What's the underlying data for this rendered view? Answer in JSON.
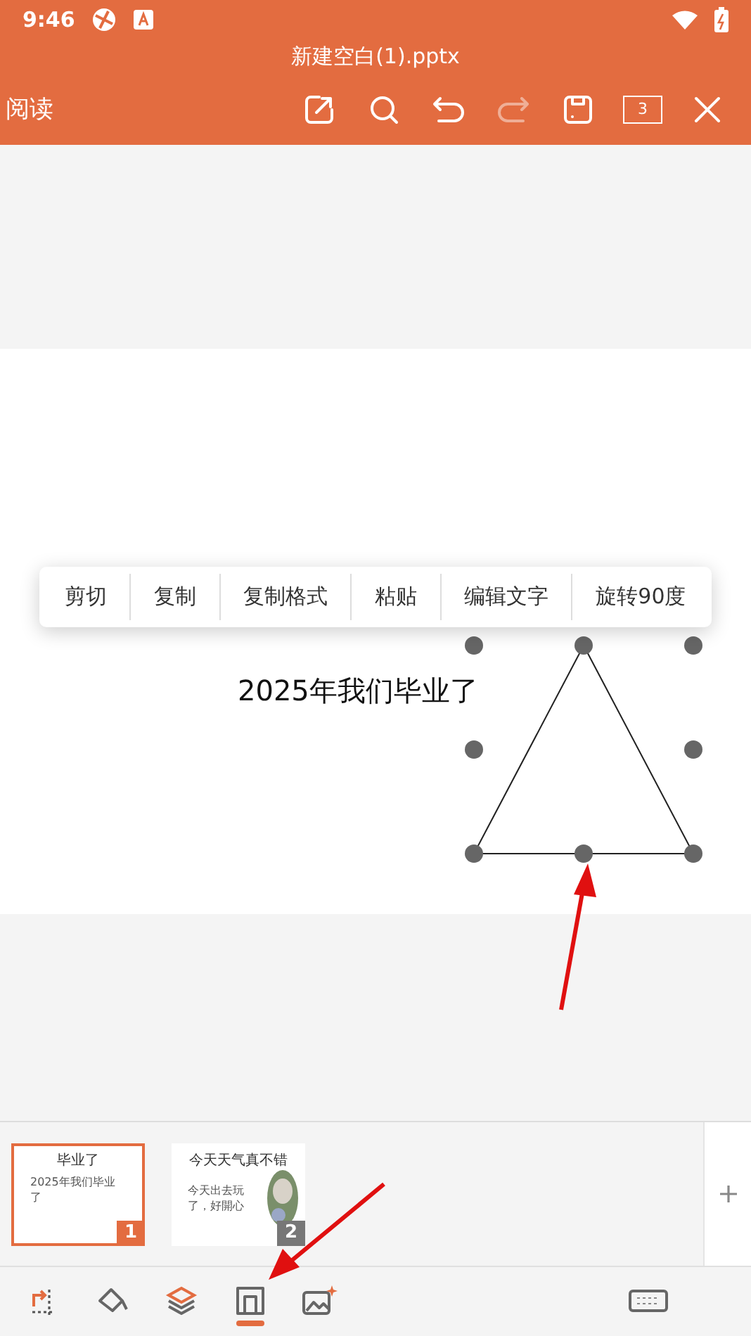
{
  "status_bar": {
    "time": "9:46"
  },
  "window": {
    "title": "新建空白(1).pptx"
  },
  "toolbar": {
    "mode_label": "阅读",
    "page_count": "3",
    "redo_disabled": true
  },
  "context_menu": {
    "items": [
      "剪切",
      "复制",
      "复制格式",
      "粘贴",
      "编辑文字",
      "旋转90度"
    ]
  },
  "slide": {
    "subtitle": "2025年我们毕业了"
  },
  "thumbnails": [
    {
      "number": "1",
      "selected": true,
      "title": "毕业了",
      "body": "2025年我们毕业了",
      "kind": "text"
    },
    {
      "number": "2",
      "selected": false,
      "title": "今天天气真不错",
      "body": "今天出去玩了，好開心",
      "kind": "picture"
    }
  ],
  "bottom_tools": [
    {
      "selected": false
    },
    {
      "selected": false
    },
    {
      "selected": false
    },
    {
      "selected": true
    },
    {
      "selected": false
    },
    {
      "selected": false
    }
  ]
}
